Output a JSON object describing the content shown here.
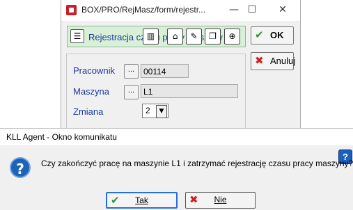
{
  "background_window": {
    "title": "BOX/PRO/RejMasz/form/rejestr...",
    "window_controls": {
      "minimize": "—",
      "maximize": "☐",
      "close": "✕"
    },
    "panel_label": "Rejestracja czasu pracy maszyny",
    "toolbar_icons": [
      "barcode-icon",
      "home-icon",
      "note-icon",
      "windows-icon",
      "lifebuoy-icon"
    ],
    "ok_label": "OK",
    "cancel_label": "Anuluj",
    "form": {
      "pracownik_label": "Pracownik",
      "pracownik_value": "00114",
      "maszyna_label": "Maszyna",
      "maszyna_value": "L1",
      "zmiana_label": "Zmiana",
      "zmiana_value": "2",
      "lookup_label": "..."
    }
  },
  "dialog": {
    "title": "KLL Agent - Okno komunikatu",
    "message": "Czy zakończyć pracę na maszynie L1 i zatrzymać rejestrację czasu pracy maszyny?",
    "yes_label": "Tak",
    "no_label": "Nie",
    "help_glyph": "?",
    "question_glyph": "?"
  },
  "colors": {
    "panel_green": "#d8f0d8",
    "label_blue": "#1a3a9a",
    "dialog_bg": "#f0f0f0",
    "accent_blue": "#2a6fd6"
  }
}
